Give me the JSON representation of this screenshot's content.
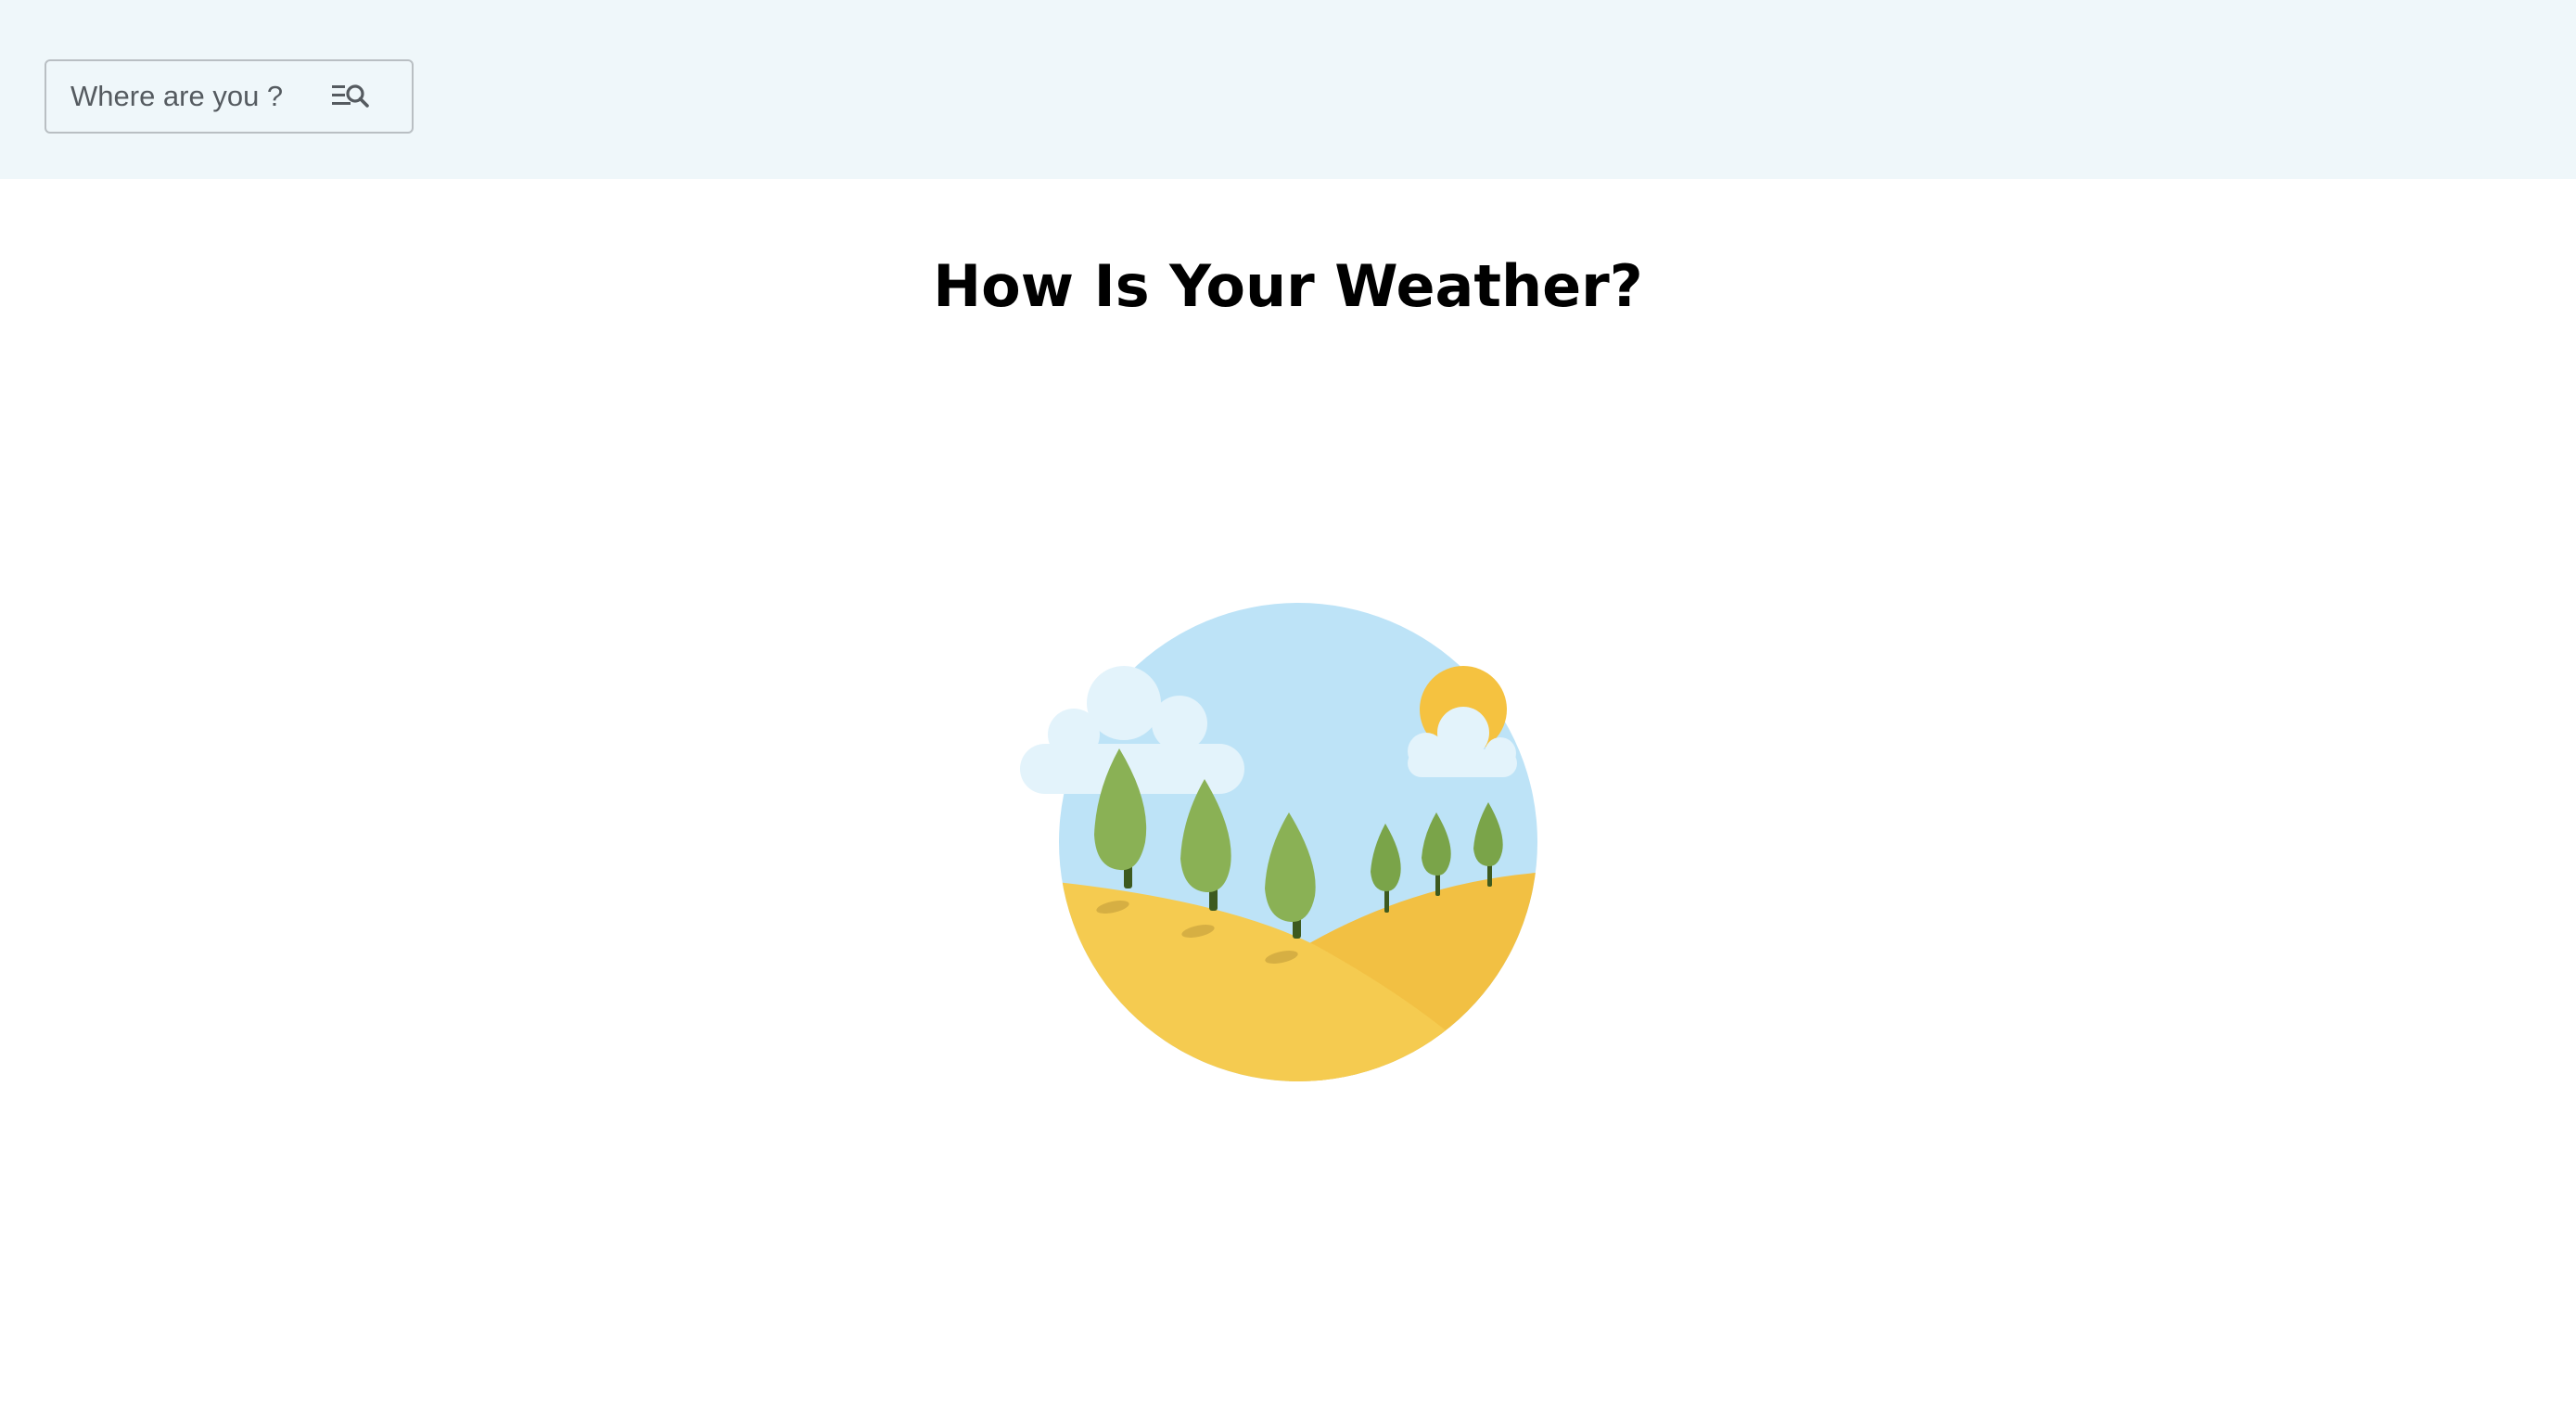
{
  "header": {
    "search": {
      "placeholder": "Where are you ?",
      "icon": "search-list-icon"
    }
  },
  "main": {
    "title": "How Is Your Weather?",
    "illustration": "landscape-sun-clouds-trees"
  },
  "colors": {
    "header_bg": "#eff7fa",
    "sky": "#bde3f7",
    "cloud": "#e3f3fb",
    "sun": "#f5c240",
    "hill": "#f5cb50",
    "tree": "#8ab155",
    "trunk": "#3d5a1f"
  }
}
